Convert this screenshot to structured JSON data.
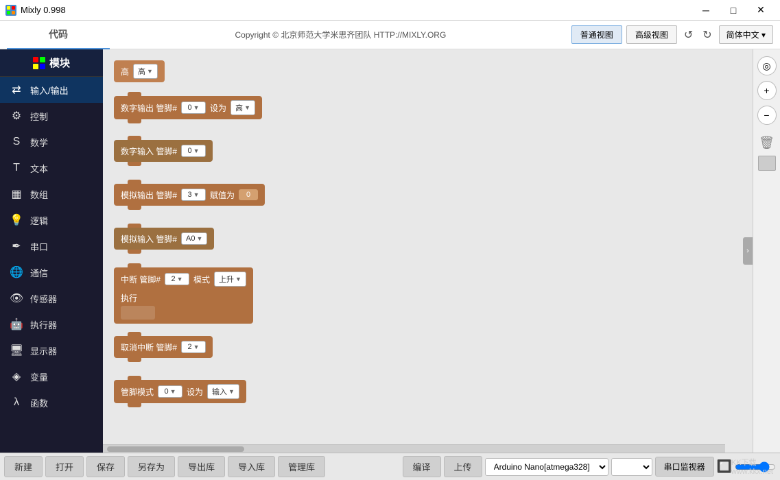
{
  "titlebar": {
    "title": "Mixly 0.998",
    "minimize": "─",
    "maximize": "□",
    "close": "✕"
  },
  "toolbar": {
    "tab_label": "代码",
    "copyright": "Copyright © 北京师范大学米思齐团队 HTTP://MIXLY.ORG",
    "view_normal": "普通视图",
    "view_advanced": "高级视图",
    "undo": "↺",
    "redo": "↻",
    "lang": "简体中文 ▾"
  },
  "sidebar": {
    "header": "模块",
    "items": [
      {
        "id": "io",
        "label": "输入/输出",
        "icon": "⇄",
        "active": true
      },
      {
        "id": "control",
        "label": "控制",
        "icon": "⚙"
      },
      {
        "id": "math",
        "label": "数学",
        "icon": "S"
      },
      {
        "id": "text",
        "label": "文本",
        "icon": "T"
      },
      {
        "id": "array",
        "label": "数组",
        "icon": "▦"
      },
      {
        "id": "logic",
        "label": "逻辑",
        "icon": "💡"
      },
      {
        "id": "serial",
        "label": "串口",
        "icon": "✒"
      },
      {
        "id": "comm",
        "label": "通信",
        "icon": "🌐"
      },
      {
        "id": "sensor",
        "label": "传感器",
        "icon": "👁"
      },
      {
        "id": "actuator",
        "label": "执行器",
        "icon": "🤖"
      },
      {
        "id": "display",
        "label": "显示器",
        "icon": "🖥"
      },
      {
        "id": "variable",
        "label": "变量",
        "icon": "◈"
      },
      {
        "id": "function",
        "label": "函数",
        "icon": "λ"
      }
    ]
  },
  "blocks": {
    "high_block": {
      "label": "高",
      "value": "高"
    },
    "digital_out": {
      "label": "数字输出 管脚#",
      "pin": "0",
      "set": "设为",
      "value": "高"
    },
    "digital_in": {
      "label": "数字输入 管脚#",
      "pin": "0"
    },
    "analog_out": {
      "label": "模拟输出 管脚#",
      "pin": "3",
      "set": "赋值为",
      "value": "0"
    },
    "analog_in": {
      "label": "模拟输入 管脚#",
      "pin": "A0"
    },
    "interrupt": {
      "label": "中断 管脚#",
      "pin": "2",
      "mode_label": "模式",
      "mode": "上升",
      "exec": "执行"
    },
    "cancel_interrupt": {
      "label": "取消中断 管脚#",
      "pin": "2"
    },
    "pin_mode": {
      "label": "管脚模式",
      "pin": "0",
      "set": "设为",
      "mode": "输入"
    }
  },
  "bottom": {
    "new": "新建",
    "open": "打开",
    "save": "保存",
    "save_as": "另存为",
    "export": "导出库",
    "import": "导入库",
    "manage": "管理库",
    "compile": "编译",
    "upload": "上传",
    "board": "Arduino Nano[atmega328]",
    "port": "",
    "monitor": "串口监视器"
  },
  "watermark": {
    "line1": "KK下载",
    "line2": "www.kkx.net"
  }
}
